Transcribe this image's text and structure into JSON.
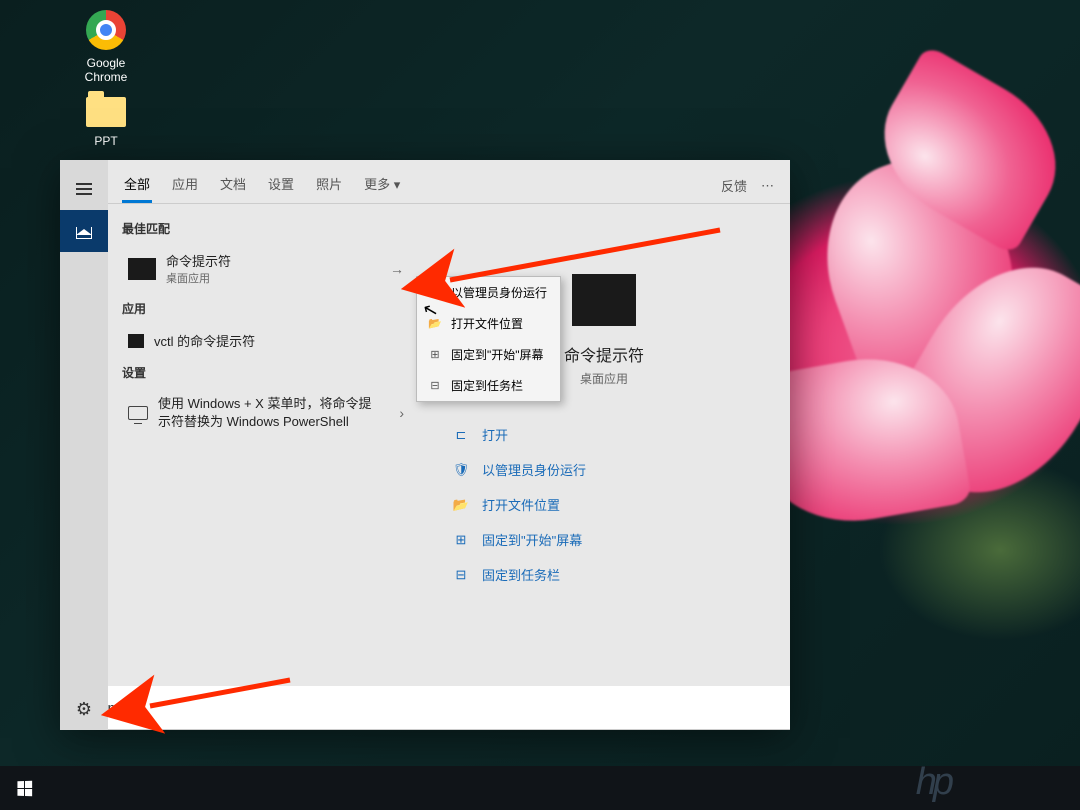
{
  "desktop": {
    "icons": [
      {
        "label": "Google Chrome"
      },
      {
        "label": "PPT"
      }
    ]
  },
  "search_panel": {
    "tabs": [
      "全部",
      "应用",
      "文档",
      "设置",
      "照片",
      "更多"
    ],
    "feedback": "反馈",
    "best_match_header": "最佳匹配",
    "best_match": {
      "title": "命令提示符",
      "subtitle": "桌面应用"
    },
    "apps_header": "应用",
    "app_result": "vctl 的命令提示符",
    "settings_header": "设置",
    "settings_result": "使用 Windows + X 菜单时，将命令提示符替换为 Windows PowerShell",
    "context_menu": [
      "以管理员身份运行",
      "打开文件位置",
      "固定到\"开始\"屏幕",
      "固定到任务栏"
    ],
    "preview": {
      "title": "命令提示符",
      "subtitle": "桌面应用",
      "actions": [
        "打开",
        "以管理员身份运行",
        "打开文件位置",
        "固定到\"开始\"屏幕",
        "固定到任务栏"
      ]
    }
  },
  "search": {
    "value": "cmd"
  }
}
